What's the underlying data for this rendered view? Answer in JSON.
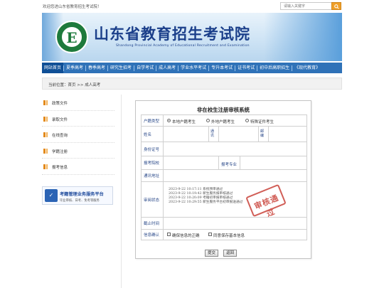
{
  "topbar": {
    "welcome": "欢迎您进山东省教育招生考试院！",
    "search_placeholder": "请输入关键字"
  },
  "banner": {
    "logo_letter": "E",
    "title": "山东省教育招生考试院",
    "subtitle": "Shandong Provincial Academy of Educational Recruitment and Examination"
  },
  "nav": {
    "items": [
      "网站首页",
      "夏季高考",
      "春季高考",
      "研究生招考",
      "自学考试",
      "成人高考",
      "学业水平考试",
      "专升本考试",
      "证书考试",
      "初中后高职招生",
      "《现代教育》"
    ]
  },
  "breadcrumb": {
    "text": "当前位置：首页 >> 成人高考"
  },
  "sidebar": {
    "items": [
      "政策文件",
      "录取文件",
      "在线查询",
      "学籍注册",
      "报考信息"
    ],
    "promo_title": "考籍管理业务服务平台",
    "promo_subtitle": "毕业审核、日考、免考等服务"
  },
  "form": {
    "title": "非在校生注册审核系统",
    "labels": {
      "type": "户籍类型",
      "name": "姓名",
      "gender": "通讯",
      "zip": "邮编",
      "id": "身份证号",
      "school": "报考院校",
      "major": "报考专业",
      "address": "通讯地址",
      "status": "审阅状态",
      "deadline": "截止时间",
      "confirm": "信息确认"
    },
    "type_options": [
      "本地户籍考生",
      "外地户籍考生",
      "特殊证件考生"
    ],
    "type_selected": "本地户籍考生",
    "status_log": [
      "2023-9-22 10:17:11 系统预审通过",
      "2023-9-22 10:19:42 新生服务报审核通过",
      "2023-9-22 10:20:09 考籍初审报审核通过",
      "2023-9-22 10:29:55 新生服务平台初审报送通过"
    ],
    "stamp_text": "审核通过",
    "confirm_options": [
      "确保信息的正确",
      "同意保存基本信息"
    ],
    "submit_label": "提交",
    "back_label": "返回"
  }
}
